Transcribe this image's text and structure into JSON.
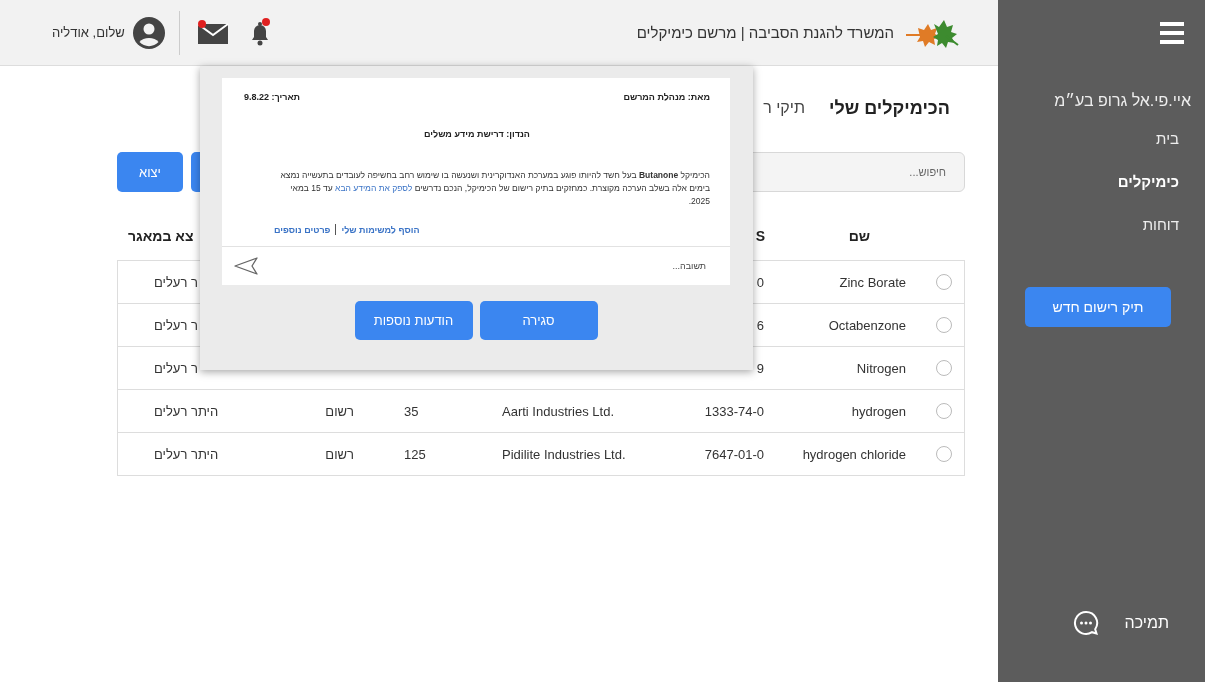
{
  "header": {
    "title": "המשרד להגנת הסביבה | מרשם כימיקלים",
    "greeting": "שלום, אודליה",
    "mail_unread": true,
    "bell_unread": true
  },
  "sidebar": {
    "company": "איי.פי.אל גרופ בע״מ",
    "items": [
      {
        "label": "בית",
        "selected": false
      },
      {
        "label": "כימיקלים",
        "selected": true
      },
      {
        "label": "דוחות",
        "selected": false
      }
    ],
    "new_button": "תיק רישום חדש",
    "support": "תמיכה"
  },
  "tabs": [
    {
      "label": "הכימיקלים שלי",
      "selected": true
    },
    {
      "label": "תיקי ר",
      "selected": false
    }
  ],
  "search": {
    "placeholder": "חיפוש..."
  },
  "export_button": "יצוא",
  "table": {
    "columns": [
      "שם",
      "S",
      "",
      "",
      "",
      "צא במאגר"
    ],
    "rows": [
      {
        "selected": false,
        "name": "Zinc Borate",
        "cas": "0",
        "permit": "ר רעלים"
      },
      {
        "selected": false,
        "name": "Octabenzone",
        "cas": "6",
        "permit": "ר רעלים"
      },
      {
        "selected": false,
        "name": "Nitrogen",
        "cas": "9",
        "permit": "ר רעלים"
      },
      {
        "selected": false,
        "name": "hydrogen",
        "cas": "1333-74-0",
        "company": "Aarti Industries Ltd.",
        "quantity": "35",
        "status": "רשום",
        "permit": "היתר רעלים"
      },
      {
        "selected": false,
        "name": "hydrogen chloride",
        "cas": "7647-01-0",
        "company": "Pidilite Industries Ltd.",
        "quantity": "125",
        "status": "רשום",
        "permit": "היתר רעלים"
      }
    ]
  },
  "message": {
    "from": "מאת: מנהלת המרשם",
    "date": "תאריך: 9.8.22",
    "subject": "הנדון: דרישת מידע משלים",
    "body": [
      {
        "kind": "text",
        "text": "הכימיקל **Butanone** בעל חשד להיותו פוגע במערכת האנדוקרינית ושנעשה בו שימוש רחב בחשיפה לעובדים בתעשייה נמצא בימים אלה בשלב הערכה מקוצרת. כמחזקים בתיק רישום של הכימיקל, הנכם נדרשים "
      },
      {
        "kind": "link",
        "text": "לספק את המידע הבא"
      },
      {
        "kind": "text",
        "text": " עד 15 במאי 2025."
      }
    ],
    "links": [
      "הוסף למשימות שלי",
      "פרטים נוספים"
    ],
    "reply": {
      "placeholder": "תשובה..."
    },
    "buttons": [
      "סגירה",
      "הודעות נוספות"
    ]
  }
}
